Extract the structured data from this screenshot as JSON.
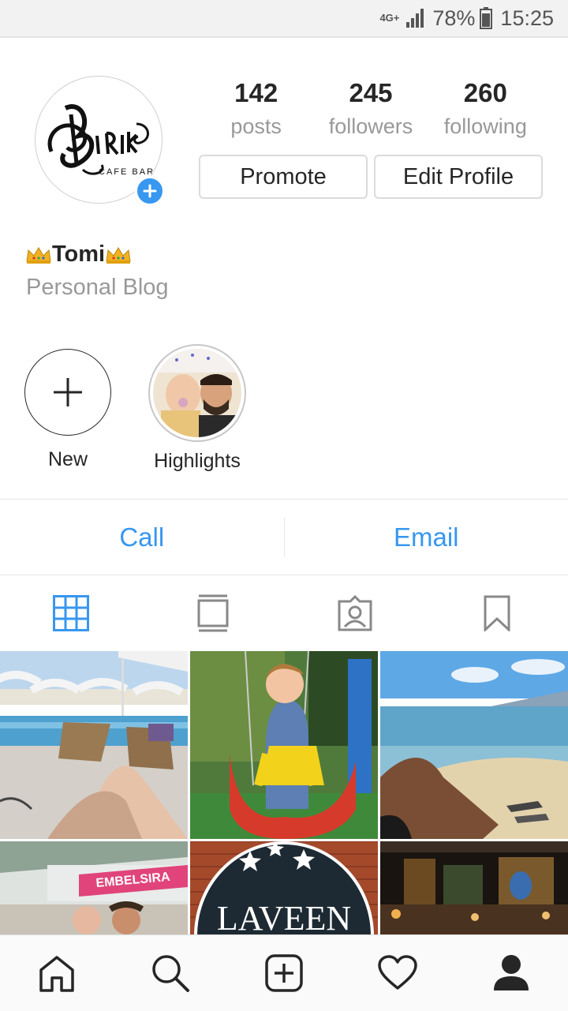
{
  "status_bar": {
    "network": "4G+",
    "battery_percent": "78%",
    "time": "15:25"
  },
  "profile": {
    "avatar_logo_text": "BRiKi CAFE BAR",
    "name": "Tomi",
    "category": "Personal Blog",
    "stats": [
      {
        "value": "142",
        "label": "posts"
      },
      {
        "value": "245",
        "label": "followers"
      },
      {
        "value": "260",
        "label": "following"
      }
    ],
    "buttons": {
      "promote": "Promote",
      "edit_profile": "Edit Profile"
    }
  },
  "highlights": [
    {
      "label": "New",
      "icon": "plus-icon"
    },
    {
      "label": "Highlights",
      "icon": "photo-thumbnail"
    }
  ],
  "contact": {
    "call": "Call",
    "email": "Email"
  },
  "tabs": [
    {
      "icon": "grid-icon",
      "active": true
    },
    {
      "icon": "feed-icon",
      "active": false
    },
    {
      "icon": "tagged-icon",
      "active": false
    },
    {
      "icon": "saved-icon",
      "active": false
    }
  ],
  "grid_photos": [
    {
      "subject": "pool"
    },
    {
      "subject": "child-on-swing"
    },
    {
      "subject": "beach"
    },
    {
      "subject": "store",
      "sign_text": "EMBELSIRA"
    },
    {
      "subject": "restaurant-sign",
      "sign_text": "LAVEEN"
    },
    {
      "subject": "night-terrace"
    }
  ],
  "bottom_nav": [
    {
      "icon": "home-icon"
    },
    {
      "icon": "search-icon"
    },
    {
      "icon": "new-post-icon"
    },
    {
      "icon": "activity-heart-icon"
    },
    {
      "icon": "profile-icon",
      "active": true
    }
  ],
  "colors": {
    "accent": "#3897f0",
    "text": "#262626",
    "muted": "#999999"
  }
}
